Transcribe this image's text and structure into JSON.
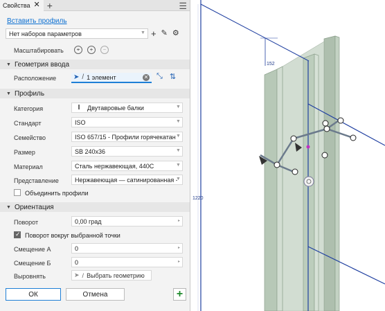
{
  "panel": {
    "tab_title": "Свойства",
    "tab_close": "✕",
    "tab_add": "+",
    "menu_icon": "hamburger-icon",
    "insert_profile_link": "Вставить профиль",
    "presets": {
      "value": "Нет наборов параметров"
    },
    "preset_tools": [
      "plus-icon",
      "pencil-icon",
      "gear-icon"
    ],
    "scale_label": "Масштабировать",
    "scale_icons": [
      "zoom-fit-icon",
      "zoom-in-icon",
      "zoom-out-icon"
    ]
  },
  "geometry": {
    "title": "Геометрия ввода",
    "placement_label": "Расположение",
    "placement_value": "1 элемент",
    "tools": [
      "orient-icon",
      "flip-icon"
    ]
  },
  "profile": {
    "title": "Профиль",
    "fields": [
      {
        "label": "Категория",
        "value": "Двутавровые балки",
        "icon": "i-beam-icon"
      },
      {
        "label": "Стандарт",
        "value": "ISO"
      },
      {
        "label": "Семейство",
        "value": "ISO 657/15 - Профили горячекатан"
      },
      {
        "label": "Размер",
        "value": "SB 240x36"
      },
      {
        "label": "Материал",
        "value": "Сталь нержавеющая, 440C"
      },
      {
        "label": "Представление",
        "value": "Нержавеющая — сатинированная -"
      }
    ],
    "merge_label": "Объединить профили",
    "merge_checked": false
  },
  "orientation": {
    "title": "Ориентация",
    "rotation_label": "Поворот",
    "rotation_value": "0,00 град",
    "rotate_about_label": "Поворот вокруг выбранной точки",
    "rotate_about_checked": true,
    "offset_a_label": "Смещение А",
    "offset_a_value": "0",
    "offset_b_label": "Смещение Б",
    "offset_b_value": "0",
    "align_label": "Выровнять",
    "align_value": "Выбрать геометрию"
  },
  "buttons": {
    "ok": "ОК",
    "cancel": "Отмена",
    "apply": "+"
  },
  "viewport": {
    "dim_top": "152",
    "dim_left": "1220"
  },
  "colors": {
    "accent": "#1e7fd6",
    "link": "#0a6ed1",
    "beam_fill": "#b9cbb9",
    "dimension": "#1e3a8a",
    "apply_green": "#1f8a2c"
  }
}
